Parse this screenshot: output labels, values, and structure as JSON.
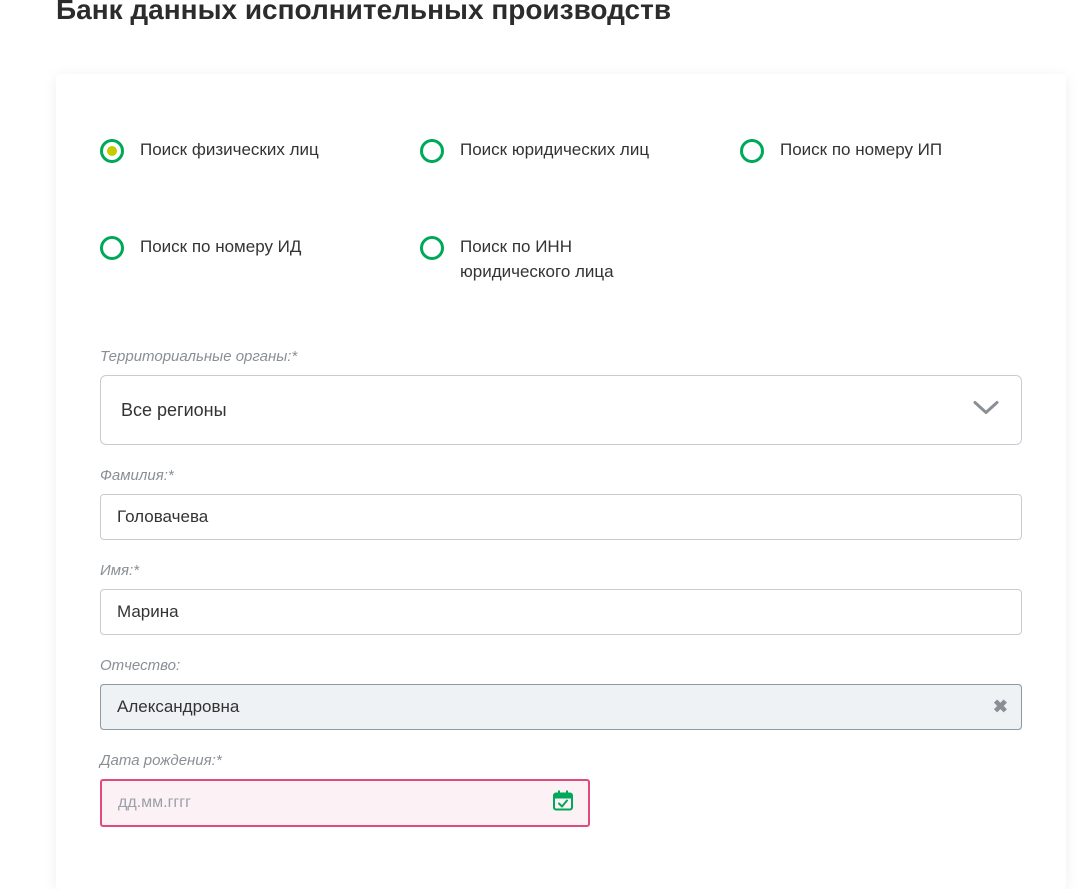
{
  "title": "Банк данных исполнительных производств",
  "radios": [
    {
      "label": "Поиск физических лиц",
      "selected": true
    },
    {
      "label": "Поиск юридических лиц",
      "selected": false
    },
    {
      "label": "Поиск по номеру ИП",
      "selected": false
    },
    {
      "label": "Поиск по номеру ИД",
      "selected": false
    },
    {
      "label": "Поиск по ИНН юридического лица",
      "selected": false
    }
  ],
  "fields": {
    "region": {
      "label": "Территориальные органы:*",
      "value": "Все регионы"
    },
    "lastname": {
      "label": "Фамилия:*",
      "value": "Головачева"
    },
    "firstname": {
      "label": "Имя:*",
      "value": "Марина"
    },
    "patronymic": {
      "label": "Отчество:",
      "value": "Александровна"
    },
    "birthdate": {
      "label": "Дата рождения:*",
      "placeholder": "дд.мм.гггг",
      "value": ""
    }
  }
}
